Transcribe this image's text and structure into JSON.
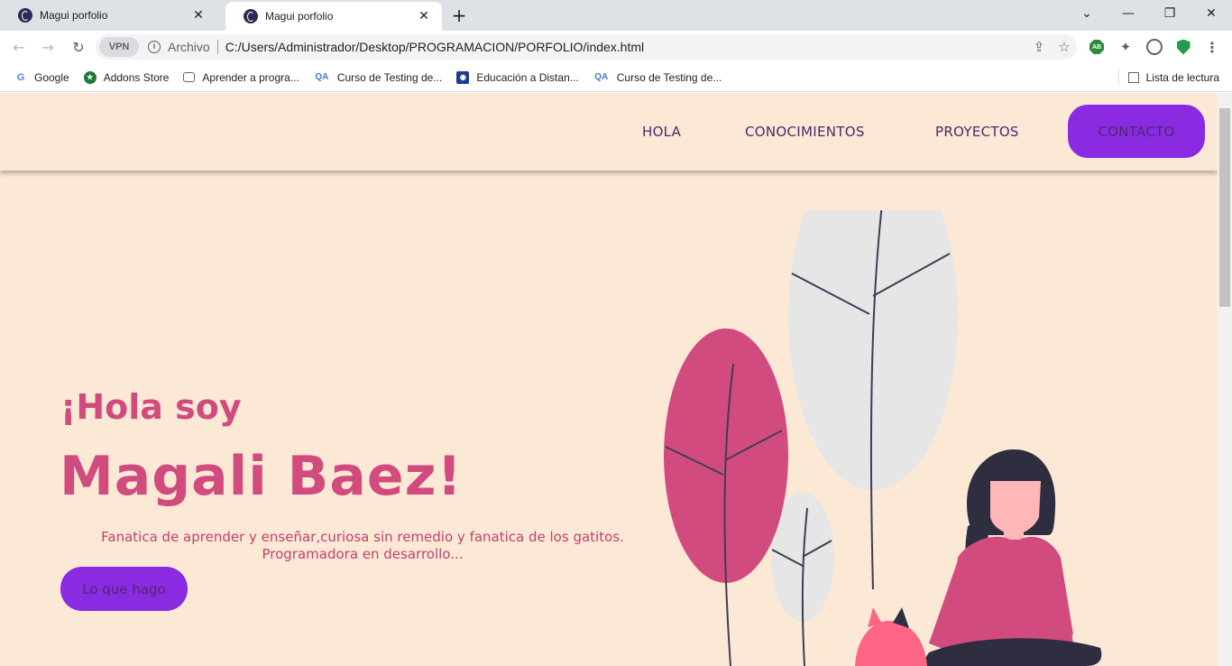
{
  "browser": {
    "tabs": [
      {
        "title": "Magui porfolio",
        "close": "✕"
      },
      {
        "title": "Magui porfolio",
        "close": "✕"
      }
    ],
    "new_tab": "+",
    "window_controls": {
      "dropdown": "⌄",
      "minimize": "—",
      "maximize": "❐",
      "close": "✕"
    },
    "nav": {
      "back": "←",
      "forward": "→",
      "reload": "↻"
    },
    "vpn_label": "VPN",
    "info": "i",
    "scheme_label": "Archivo",
    "url": "C:/Users/Administrador/Desktop/PROGRAMACION/PORFOLIO/index.html",
    "share_icon": "⇪",
    "star_icon": "☆",
    "extensions": {
      "abp": "AB",
      "puzzle": "✦",
      "menu": "⋮"
    },
    "bookmarks": [
      {
        "label": "Google",
        "icon": "google-icon",
        "glyph": "G"
      },
      {
        "label": "Addons Store",
        "icon": "addons-store-icon",
        "glyph": "★"
      },
      {
        "label": "Aprender a progra...",
        "icon": "cup-icon",
        "glyph": ""
      },
      {
        "label": "Curso de Testing de...",
        "icon": "qa-icon",
        "glyph": "QA"
      },
      {
        "label": "Educación a Distan...",
        "icon": "edu-icon",
        "glyph": "◉"
      },
      {
        "label": "Curso de Testing de...",
        "icon": "qa-icon",
        "glyph": "QA"
      }
    ],
    "reading_list": "Lista de lectura"
  },
  "site": {
    "nav": {
      "hola": "HOLA",
      "conocimientos": "CONOCIMIENTOS",
      "proyectos": "PROYECTOS",
      "contacto": "CONTACTO"
    },
    "hero": {
      "greeting": "¡Hola soy",
      "name": "Magali Baez!",
      "description_line1": "Fanatica de aprender y enseñar,curiosa sin remedio y fanatica de los gatitos.",
      "description_line2": "Programadora en desarrollo...",
      "cta": "Lo que hago"
    }
  },
  "colors": {
    "page_bg": "#fbe9d6",
    "accent_purple": "#8a2be2",
    "pink": "#d24b7e",
    "nav_text": "#4a2a6e",
    "leaf_grey": "#e6e6e6",
    "leaf_pink": "#d24b7e"
  }
}
